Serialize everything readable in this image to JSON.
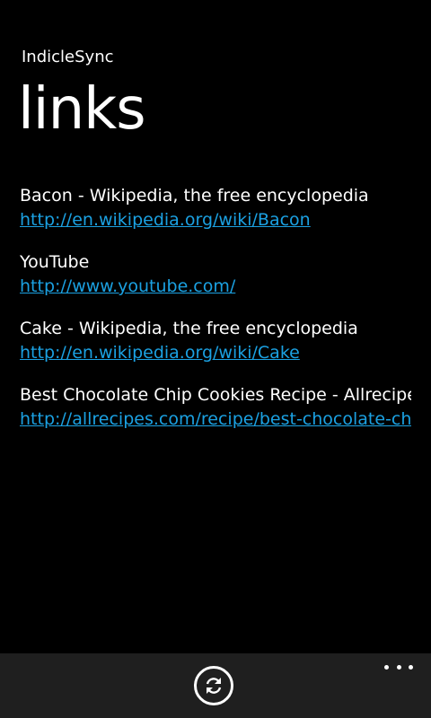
{
  "app": {
    "title": "IndicleSync"
  },
  "page": {
    "title": "links"
  },
  "links": [
    {
      "title": "Bacon - Wikipedia, the free encyclopedia",
      "url": "http://en.wikipedia.org/wiki/Bacon"
    },
    {
      "title": "YouTube",
      "url": "http://www.youtube.com/"
    },
    {
      "title": "Cake - Wikipedia, the free encyclopedia",
      "url": "http://en.wikipedia.org/wiki/Cake"
    },
    {
      "title": "Best Chocolate Chip Cookies Recipe - Allrecipes.com",
      "url": "http://allrecipes.com/recipe/best-chocolate-chip-cookies/"
    }
  ],
  "app_bar": {
    "sync_icon": "sync-icon",
    "more_icon": "ellipsis-icon"
  },
  "colors": {
    "background": "#000000",
    "accent": "#1ba1e2",
    "app_bar": "#1f1f1f"
  }
}
